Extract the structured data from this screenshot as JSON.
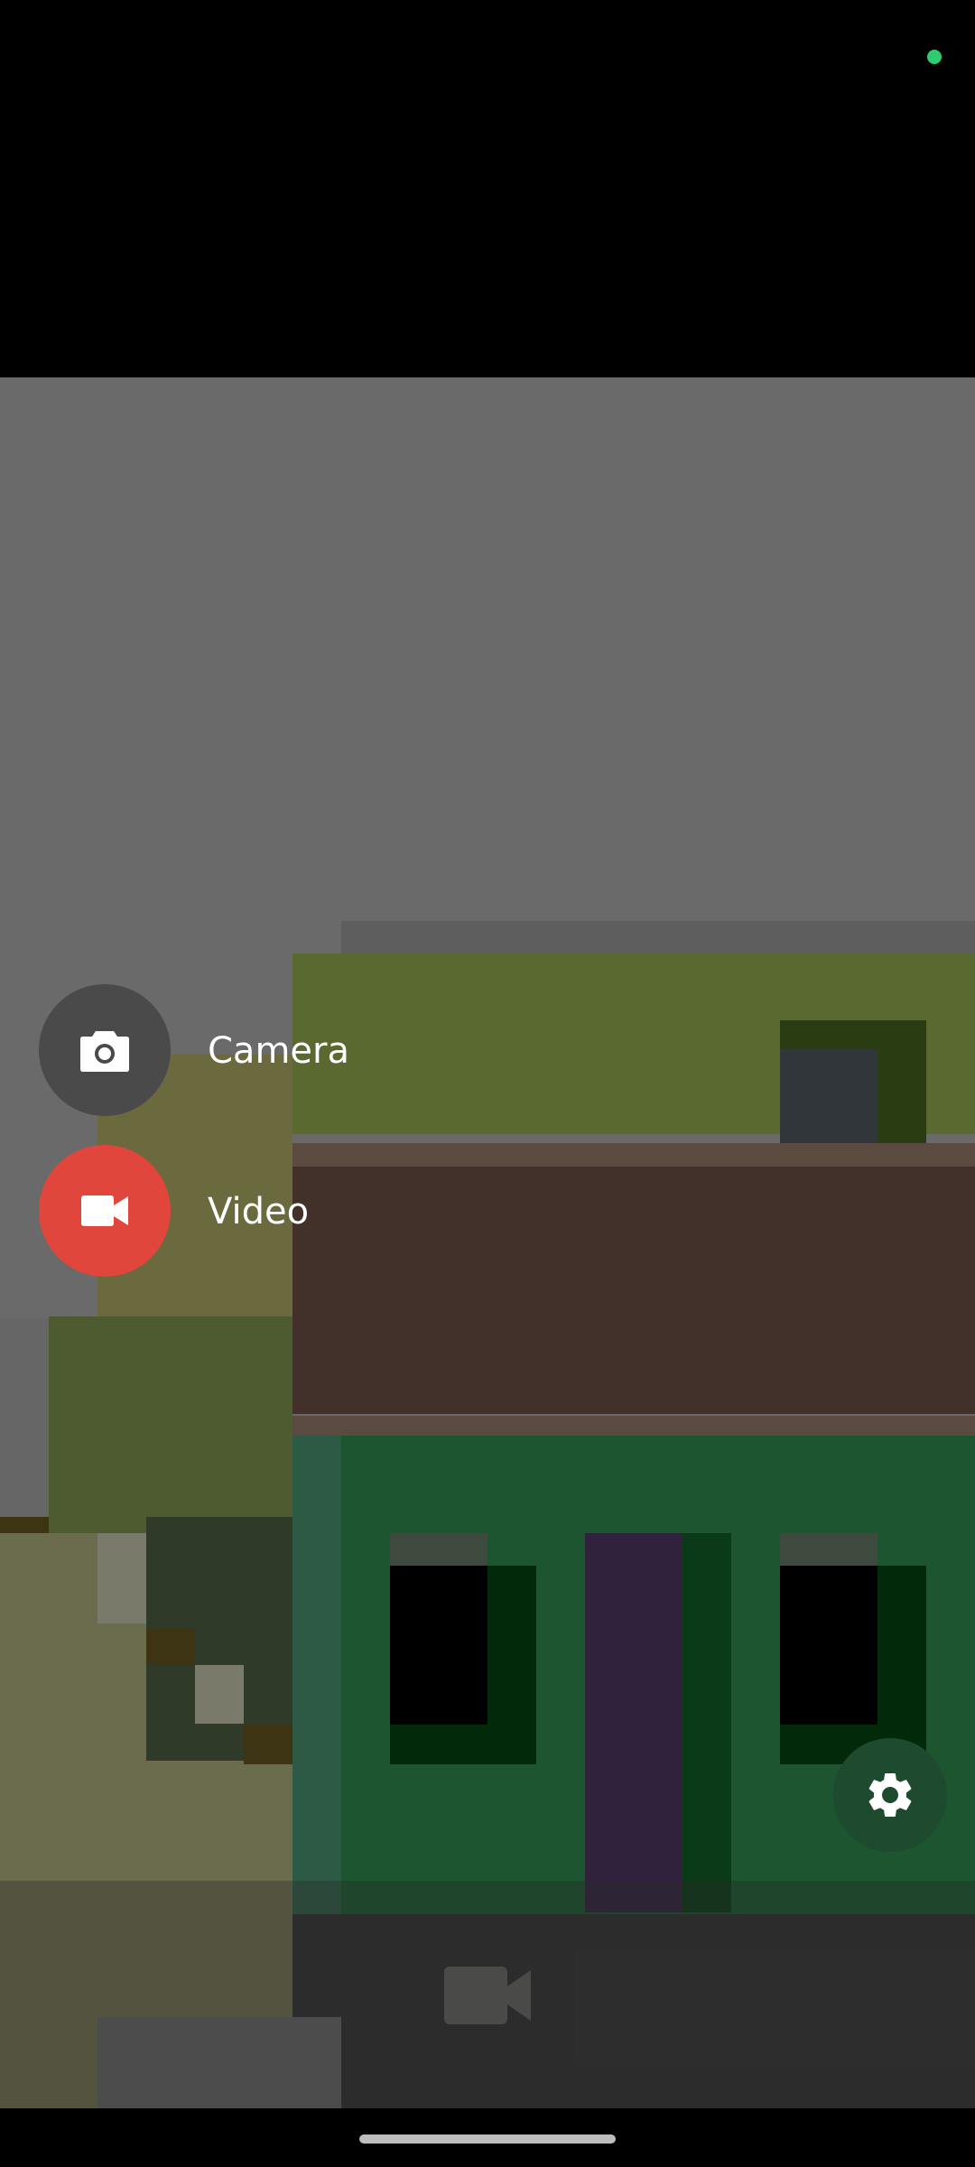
{
  "colors": {
    "status_indicator": "#2ecc71",
    "camera_fab": "#4a4a4a",
    "video_fab": "#e0463c",
    "settings_button": "#1e4a30",
    "label_text": "#ffffff"
  },
  "menu": {
    "camera_label": "Camera",
    "video_label": "Video",
    "camera_icon": "camera-icon",
    "video_icon": "videocam-icon"
  },
  "settings": {
    "icon": "gear-icon"
  },
  "bottom": {
    "record_icon": "videocam-icon"
  }
}
